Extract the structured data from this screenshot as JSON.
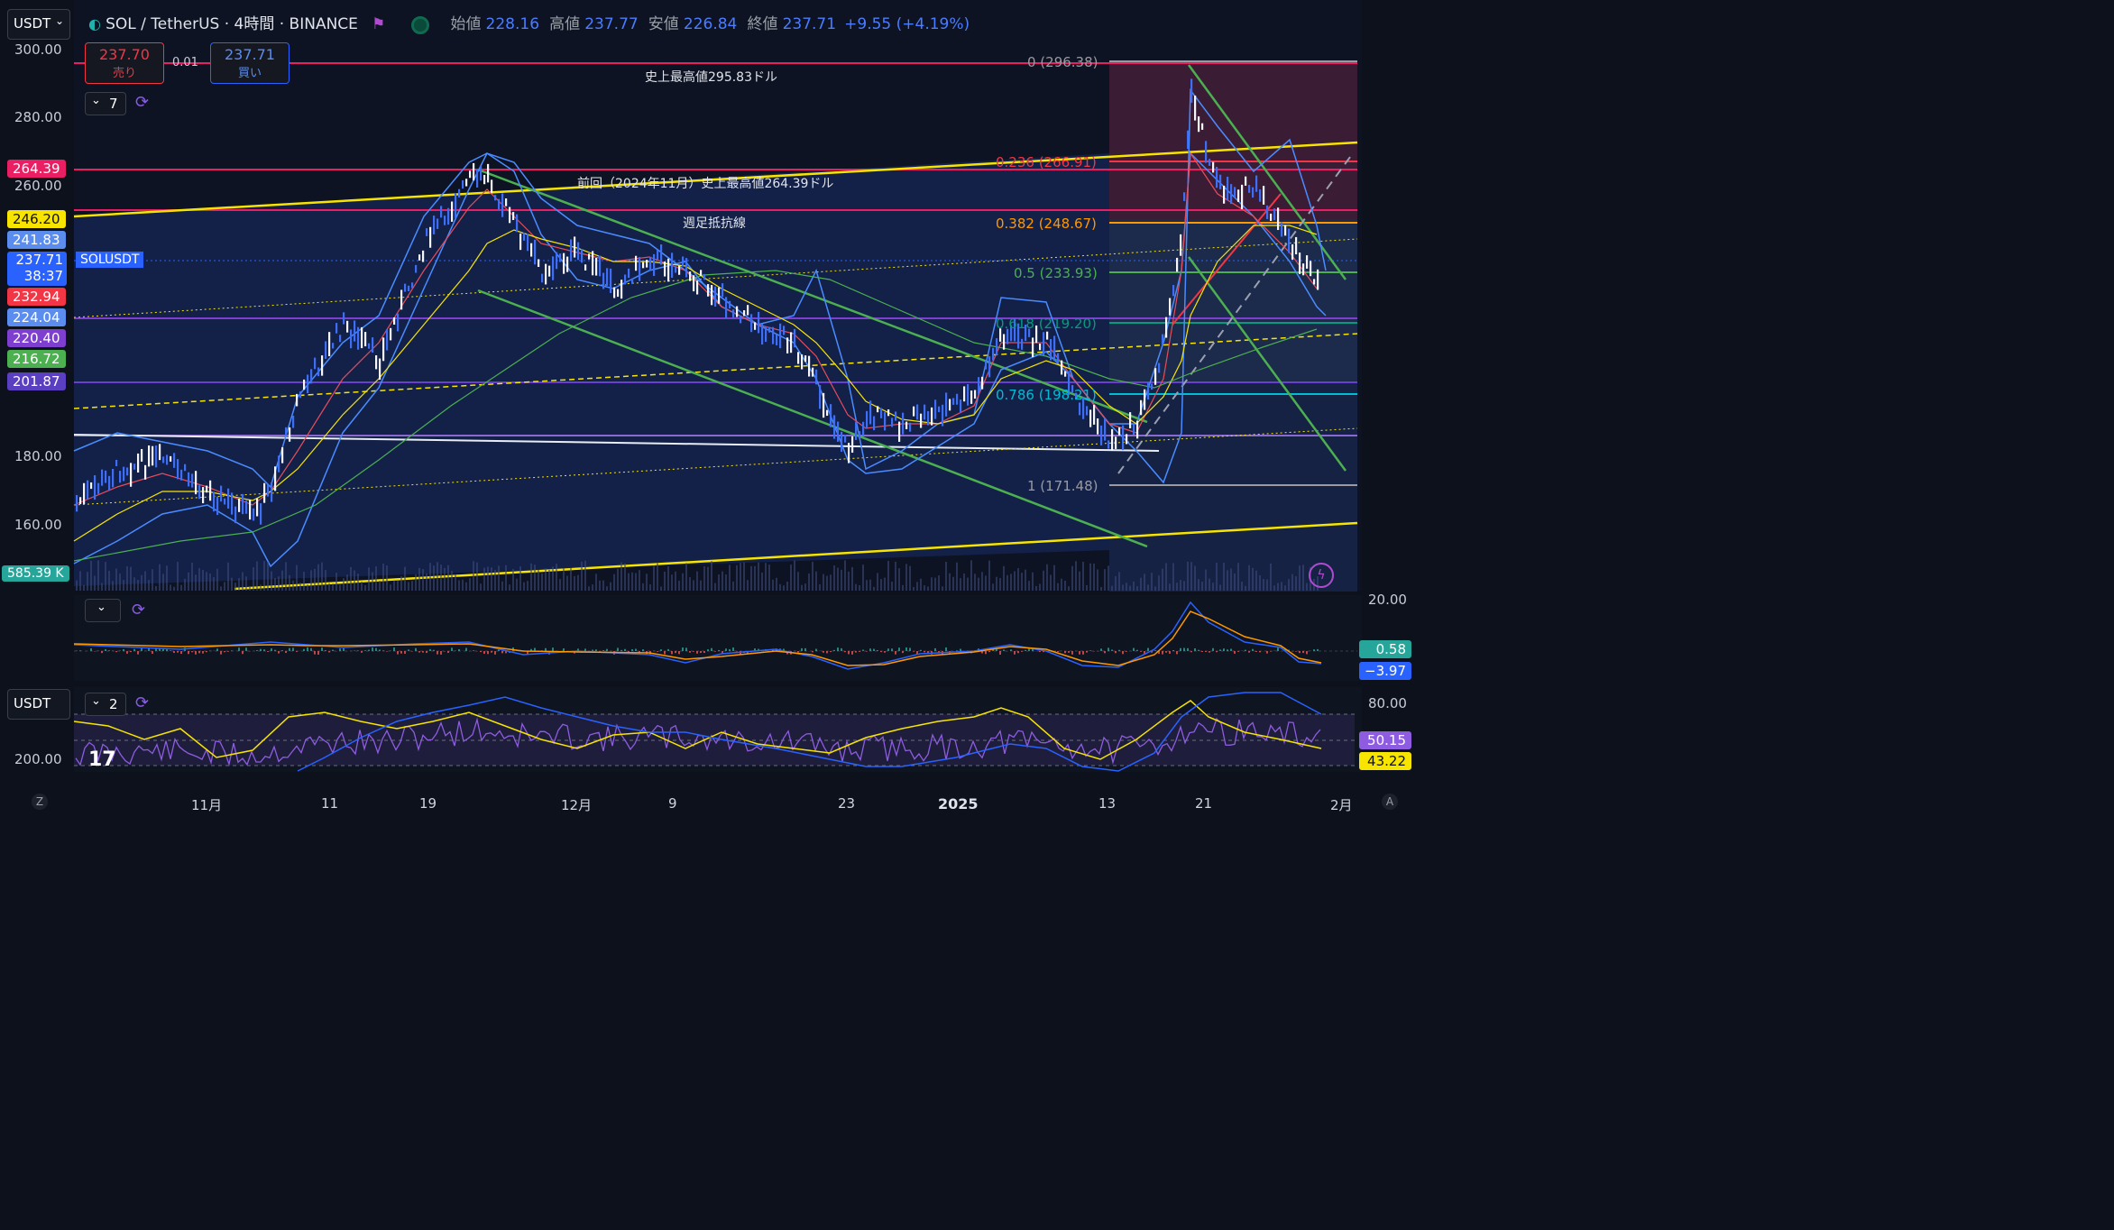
{
  "header": {
    "currency": "USDT",
    "symbol_title": "SOL / TetherUS · 4時間 · BINANCE",
    "open_label": "始値",
    "open_value": "228.16",
    "high_label": "高値",
    "high_value": "237.77",
    "low_label": "安値",
    "low_value": "226.84",
    "close_label": "終値",
    "close_value": "237.71",
    "change": "+9.55 (+4.19%)"
  },
  "trade": {
    "sell_price": "237.70",
    "sell_label": "売り",
    "spread": "0.01",
    "buy_price": "237.71",
    "buy_label": "買い"
  },
  "indicator_counts": {
    "main": "7",
    "sub2": "2"
  },
  "annotations": {
    "ath": "史上最高値295.83ドル",
    "prev_ath": "前回（2024年11月）史上最高値264.39ドル",
    "weekly_resistance": "週足抵抗線",
    "symbol_tag": "SOLUSDT"
  },
  "fib_labels": [
    "0 (296.38)",
    "0.236 (266.91)",
    "0.382 (248.67)",
    "0.5 (233.93)",
    "0.618 (219.20)",
    "0.786 (198.21)",
    "1 (171.48)"
  ],
  "price_axis": [
    "300.00",
    "280.00",
    "260.00",
    "180.00",
    "160.00"
  ],
  "price_tags": [
    {
      "text": "264.39",
      "color": "#e91e63"
    },
    {
      "text": "246.20",
      "color": "#f7e400"
    },
    {
      "text": "241.83",
      "color": "#5b8def"
    },
    {
      "text": "237.71",
      "color": "#2962ff"
    },
    {
      "text": "38:37",
      "color": "#2962ff"
    },
    {
      "text": "232.94",
      "color": "#f23645"
    },
    {
      "text": "224.04",
      "color": "#5b8def"
    },
    {
      "text": "220.40",
      "color": "#7e3fd0"
    },
    {
      "text": "216.72",
      "color": "#4caf50"
    },
    {
      "text": "201.87",
      "color": "#5a3fc0"
    }
  ],
  "volume_tag": "585.39 K",
  "macd": {
    "axis_top": "20.00",
    "value1": "0.58",
    "value2": "−3.97"
  },
  "rsi": {
    "currency": "USDT",
    "axis_top": "80.00",
    "axis_left": "200.00",
    "value1": "50.15",
    "value2": "43.22"
  },
  "time_axis": [
    "11月",
    "11",
    "19",
    "12月",
    "9",
    "23",
    "2025",
    "13",
    "21",
    "2月"
  ],
  "corner_left": "Z",
  "corner_right": "A"
}
